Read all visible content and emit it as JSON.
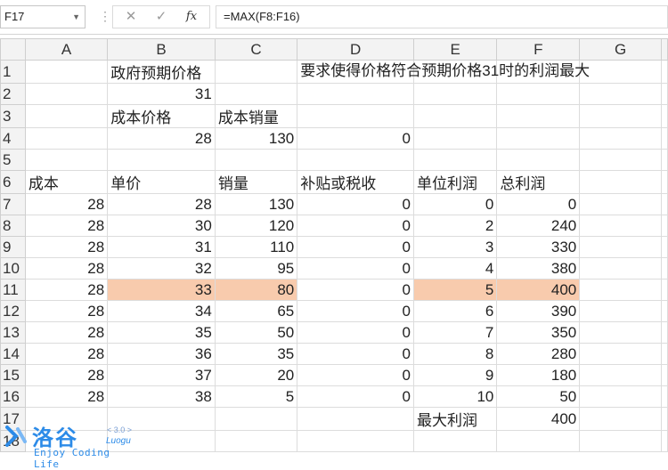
{
  "formula_bar": {
    "cell_ref": "F17",
    "dropdown_icon": "chevron-down-icon",
    "separator": "⋮",
    "cancel_icon": "✕",
    "enter_icon": "✓",
    "fx_label": "fx",
    "formula": "=MAX(F8:F16)"
  },
  "columns": [
    "A",
    "B",
    "C",
    "D",
    "E",
    "F",
    "G"
  ],
  "rows": [
    {
      "num": "1",
      "cells": [
        "",
        "政府预期价格",
        "",
        "要求使得价格符合预期价格31时的利润最大",
        "",
        "",
        ""
      ]
    },
    {
      "num": "2",
      "cells": [
        "",
        "31",
        "",
        "",
        "",
        "",
        ""
      ]
    },
    {
      "num": "3",
      "cells": [
        "",
        "成本价格",
        "成本销量",
        "",
        "",
        "",
        ""
      ]
    },
    {
      "num": "4",
      "cells": [
        "",
        "28",
        "130",
        "0",
        "",
        "",
        ""
      ]
    },
    {
      "num": "5",
      "cells": [
        "",
        "",
        "",
        "",
        "",
        "",
        ""
      ]
    },
    {
      "num": "6",
      "cells": [
        "成本",
        "单价",
        "销量",
        "补贴或税收",
        "单位利润",
        "总利润",
        ""
      ]
    },
    {
      "num": "7",
      "cells": [
        "28",
        "28",
        "130",
        "0",
        "0",
        "0",
        ""
      ]
    },
    {
      "num": "8",
      "cells": [
        "28",
        "30",
        "120",
        "0",
        "2",
        "240",
        ""
      ]
    },
    {
      "num": "9",
      "cells": [
        "28",
        "31",
        "110",
        "0",
        "3",
        "330",
        ""
      ]
    },
    {
      "num": "10",
      "cells": [
        "28",
        "32",
        "95",
        "0",
        "4",
        "380",
        ""
      ]
    },
    {
      "num": "11",
      "cells": [
        "28",
        "33",
        "80",
        "0",
        "5",
        "400",
        ""
      ]
    },
    {
      "num": "12",
      "cells": [
        "28",
        "34",
        "65",
        "0",
        "6",
        "390",
        ""
      ]
    },
    {
      "num": "13",
      "cells": [
        "28",
        "35",
        "50",
        "0",
        "7",
        "350",
        ""
      ]
    },
    {
      "num": "14",
      "cells": [
        "28",
        "36",
        "35",
        "0",
        "8",
        "280",
        ""
      ]
    },
    {
      "num": "15",
      "cells": [
        "28",
        "37",
        "20",
        "0",
        "9",
        "180",
        ""
      ]
    },
    {
      "num": "16",
      "cells": [
        "28",
        "38",
        "5",
        "0",
        "10",
        "50",
        ""
      ]
    },
    {
      "num": "17",
      "cells": [
        "",
        "",
        "",
        "",
        "最大利润",
        "400",
        ""
      ]
    },
    {
      "num": "18",
      "cells": [
        "",
        "",
        "",
        "",
        "",
        "",
        ""
      ]
    }
  ],
  "highlight_color": "#f8cbad",
  "watermark": {
    "logo": "洛谷",
    "version": "< 3.0 >",
    "en_name": "Luogu",
    "slogan": "Enjoy Coding Life"
  }
}
